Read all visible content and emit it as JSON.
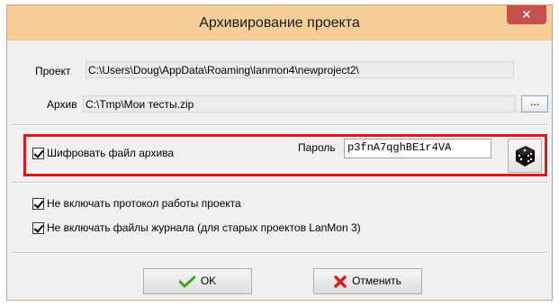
{
  "dialog": {
    "title": "Архивирование проекта",
    "close_glyph": "✕"
  },
  "project": {
    "label": "Проект",
    "path": "C:\\Users\\Doug\\AppData\\Roaming\\lanmon4\\newproject2\\"
  },
  "archive": {
    "label": "Архив",
    "path": "C:\\Tmp\\Мои тесты.zip",
    "browse_label": "..."
  },
  "encryption": {
    "checkbox_label": "Шифровать файл архива",
    "checked": true,
    "password_label": "Пароль",
    "password_value": "p3fnA7qghBE1r4VA"
  },
  "options": [
    {
      "label": "Не включать протокол работы проекта",
      "checked": true
    },
    {
      "label": "Не включать файлы журнала (для старых проектов LanMon 3)",
      "checked": true
    }
  ],
  "buttons": {
    "ok_label": "OK",
    "cancel_label": "Отменить"
  },
  "colors": {
    "titlebar": "#f5cd98",
    "close": "#c94f4f",
    "highlight_border": "#e0161f",
    "ok_icon": "#3fa61e",
    "cancel_icon": "#d41f1f"
  },
  "icons": {
    "ok": "checkmark-icon",
    "cancel": "red-x-icon",
    "generate": "dice-icon"
  }
}
